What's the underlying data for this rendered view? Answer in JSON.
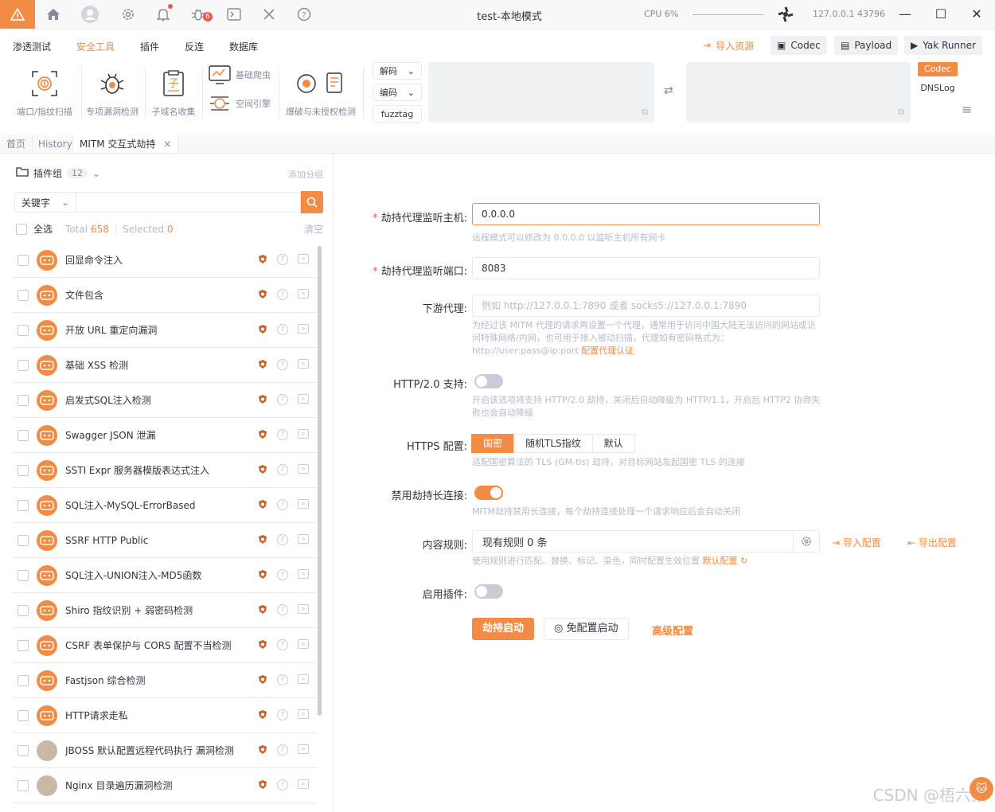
{
  "titlebar": {
    "title": "test-本地模式",
    "cpu": "CPU 6%",
    "ip": "127.0.0.1 43796",
    "bug_count": "6"
  },
  "menu": {
    "items": [
      "渗透测试",
      "安全工具",
      "插件",
      "反连",
      "数据库"
    ],
    "active_index": 1,
    "import_resources": "导入资源",
    "codec": "Codec",
    "payload": "Payload",
    "yak_runner": "Yak Runner"
  },
  "tools": {
    "port_scan": "端口/指纹扫描",
    "vuln_detect": "专项漏洞检测",
    "subdomain": "子域名收集",
    "basic_crawler": "基础爬虫",
    "space_engine": "空间引擎",
    "brute_unauth": "爆破与未授权检测",
    "decode": "解码",
    "encode": "编码",
    "fuzztag": "fuzztag",
    "codec_tab": "Codec",
    "dnslog_tab": "DNSLog"
  },
  "tabs": {
    "home": "首页",
    "history": "History",
    "mitm": "MITM 交互式劫持",
    "close": "×"
  },
  "plugins": {
    "group_label": "插件组",
    "group_count": "12",
    "add_group": "添加分组",
    "search_select": "关键字",
    "select_all": "全选",
    "total_label": "Total",
    "total": "658",
    "selected_label": "Selected",
    "selected": "0",
    "clear": "清空",
    "items": [
      {
        "name": "回显命令注入",
        "avatar": "yak"
      },
      {
        "name": "文件包含",
        "avatar": "yak"
      },
      {
        "name": "开放 URL 重定向漏洞",
        "avatar": "yak"
      },
      {
        "name": "基础 XSS 检测",
        "avatar": "yak"
      },
      {
        "name": "启发式SQL注入检测",
        "avatar": "yak"
      },
      {
        "name": "Swagger JSON 泄漏",
        "avatar": "yak"
      },
      {
        "name": "SSTI Expr 服务器模版表达式注入",
        "avatar": "yak"
      },
      {
        "name": "SQL注入-MySQL-ErrorBased",
        "avatar": "yak"
      },
      {
        "name": "SSRF HTTP Public",
        "avatar": "yak"
      },
      {
        "name": "SQL注入-UNION注入-MD5函数",
        "avatar": "yak"
      },
      {
        "name": "Shiro 指纹识别 + 弱密码检测",
        "avatar": "yak"
      },
      {
        "name": "CSRF 表单保护与 CORS 配置不当检测",
        "avatar": "yak"
      },
      {
        "name": "Fastjson 综合检测",
        "avatar": "yak"
      },
      {
        "name": "HTTP请求走私",
        "avatar": "yak"
      },
      {
        "name": "JBOSS 默认配置远程代码执行 漏洞检测",
        "avatar": "photo"
      },
      {
        "name": "Nginx 目录遍历漏洞检测",
        "avatar": "photo"
      }
    ]
  },
  "form": {
    "host_label": "劫持代理监听主机:",
    "host_value": "0.0.0.0",
    "host_help": "远程模式可以修改为 0.0.0.0 以监听主机所有网卡",
    "port_label": "劫持代理监听端口:",
    "port_value": "8083",
    "downstream_label": "下游代理:",
    "downstream_placeholder": "例如 http://127.0.0.1:7890 或者 socks5://127.0.0.1:7890",
    "downstream_help": "为经过该 MITM 代理的请求再设置一个代理，通常用于访问中国大陆无法访问的网站或访问特殊网络/内网，也可用于接入被动扫描，代理如有密码格式为：http://user:pass@ip:port",
    "downstream_link": "配置代理认证",
    "http2_label": "HTTP/2.0 支持:",
    "http2_help": "开启该选项将支持 HTTP/2.0 劫持，关闭后自动降级为 HTTP/1.1，开启后 HTTP2 协商失败也会自动降级",
    "https_label": "HTTPS 配置:",
    "https_options": [
      "国密",
      "随机TLS指纹",
      "默认"
    ],
    "https_selected": 0,
    "https_help": "适配国密算法的 TLS (GM-tls) 劫持，对目标网站发起国密 TLS 的连接",
    "keepalive_label": "禁用劫持长连接:",
    "keepalive_help": "MITM劫持禁用长连接，每个劫持连接处理一个请求响应后会自动关闭",
    "rules_label": "内容规则:",
    "rules_value": "现有规则 0 条",
    "rules_help": "使用规则进行匹配、替换、标记、染色，同时配置生效位置",
    "rules_default": "默认配置",
    "import_config": "导入配置",
    "export_config": "导出配置",
    "plugin_label": "启用插件:",
    "start_button": "劫持启动",
    "free_start_button": "免配置启动",
    "advanced": "高级配置"
  },
  "toggles": {
    "http2": false,
    "keepalive": true,
    "plugin": false
  },
  "colors": {
    "accent": "#f28b44",
    "text": "#31343f",
    "muted": "#b4bbca"
  },
  "watermark": "CSDN @梧六柒"
}
